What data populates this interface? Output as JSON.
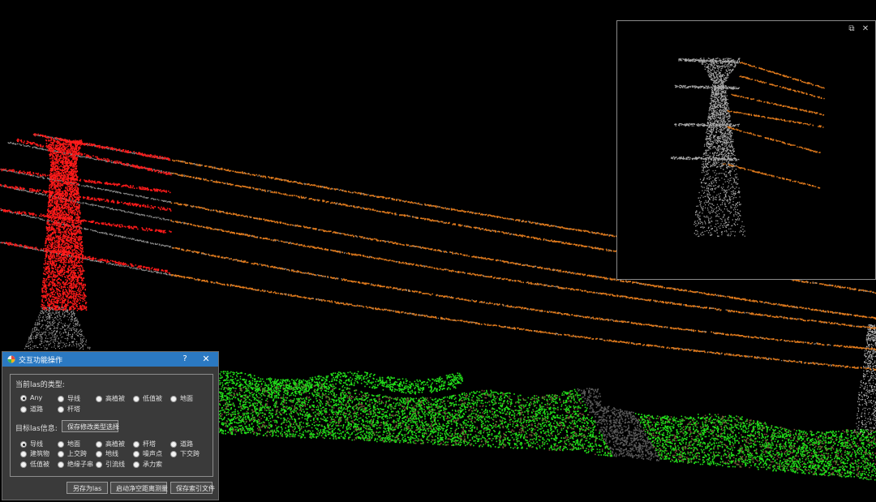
{
  "dialog": {
    "title": "交互功能操作",
    "help": "?",
    "close": "✕",
    "current_type_label": "当前las的类型:",
    "current_types": [
      {
        "label": "Any",
        "selected": true
      },
      {
        "label": "导线",
        "selected": false
      },
      {
        "label": "高植被",
        "selected": false
      },
      {
        "label": "低值被",
        "selected": false
      },
      {
        "label": "地面",
        "selected": false
      },
      {
        "label": "道路",
        "selected": false
      },
      {
        "label": "杆塔",
        "selected": false
      }
    ],
    "target_info_label": "目标las信息:",
    "save_type_button": "保存修改类型选择",
    "target_types": [
      {
        "label": "导线",
        "selected": true
      },
      {
        "label": "地面",
        "selected": false
      },
      {
        "label": "高植被",
        "selected": false
      },
      {
        "label": "杆塔",
        "selected": false
      },
      {
        "label": "道路",
        "selected": false
      },
      {
        "label": "建筑物",
        "selected": false
      },
      {
        "label": "上交跨",
        "selected": false
      },
      {
        "label": "地线",
        "selected": false
      },
      {
        "label": "噪声点",
        "selected": false
      },
      {
        "label": "下交跨",
        "selected": false
      },
      {
        "label": "低值被",
        "selected": false
      },
      {
        "label": "绝缘子串",
        "selected": false
      },
      {
        "label": "引流线",
        "selected": false
      },
      {
        "label": "承力索",
        "selected": false
      }
    ],
    "bottom_buttons": [
      "另存为las",
      "启动净空距离测量",
      "保存索引文件"
    ]
  },
  "preview_window": {
    "restore_icon": "⧉",
    "close_icon": "✕"
  },
  "colors": {
    "tower_highlight": "#ff1a1a",
    "conductor": "#e07a1c",
    "ground": "#22e01a",
    "ground_soil": "#7a4a3a",
    "road": "#5a5a5a",
    "tower_grey": "#9a9a9a",
    "titlebar": "#2b79c2"
  }
}
